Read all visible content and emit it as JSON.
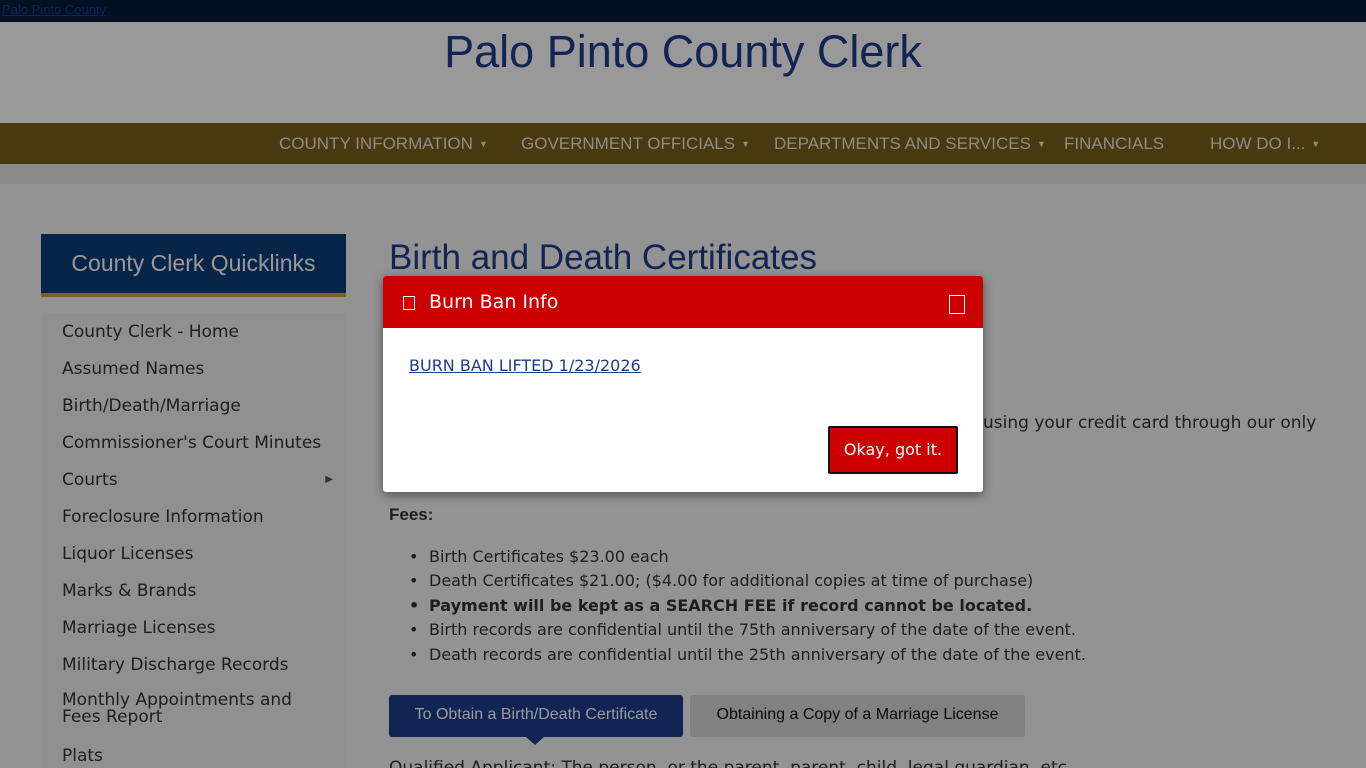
{
  "topbar": {
    "logo_alt": "Palo Pinto County"
  },
  "header": {
    "title": "Palo Pinto County Clerk"
  },
  "nav": {
    "items": [
      {
        "label": "COUNTY INFORMATION",
        "has_dropdown": true
      },
      {
        "label": "GOVERNMENT OFFICIALS",
        "has_dropdown": true
      },
      {
        "label": "DEPARTMENTS AND SERVICES",
        "has_dropdown": true
      },
      {
        "label": "FINANCIALS",
        "has_dropdown": false
      },
      {
        "label": "HOW DO I...",
        "has_dropdown": true
      }
    ],
    "caret_icon": "caret-down-icon",
    "color": "#7a5f18"
  },
  "sidebar": {
    "title": "County Clerk Quicklinks",
    "items": [
      {
        "label": "County Clerk - Home"
      },
      {
        "label": "Assumed Names"
      },
      {
        "label": "Birth/Death/Marriage"
      },
      {
        "label": "Commissioner's Court Minutes"
      },
      {
        "label": "Courts",
        "has_submenu": true
      },
      {
        "label": "Foreclosure Information"
      },
      {
        "label": "Liquor Licenses"
      },
      {
        "label": "Marks & Brands"
      },
      {
        "label": "Marriage Licenses"
      },
      {
        "label": "Military Discharge Records"
      },
      {
        "label": "Monthly Appointments and Fees Report"
      },
      {
        "label": "Plats"
      }
    ]
  },
  "main": {
    "heading": "Birth and Death Certificates",
    "intro_fragment": "using your credit card through our only",
    "fees_label": "Fees:",
    "fees": [
      {
        "text": "Birth Certificates   $23.00 each",
        "bold": false
      },
      {
        "text": "Death Certificates $21.00; ($4.00 for additional copies at time of purchase)",
        "bold": false
      },
      {
        "text": "Payment will be kept as a SEARCH FEE if record cannot be located.",
        "bold": true
      },
      {
        "text": "Birth records are confidential until the 75th anniversary of the date of the event.",
        "bold": false
      },
      {
        "text": "Death records are confidential until the 25th anniversary of the date of the event.",
        "bold": false
      }
    ],
    "tabs": [
      {
        "label": "To Obtain a Birth/Death Certificate",
        "active": true
      },
      {
        "label": "Obtaining a Copy of a Marriage License",
        "active": false
      }
    ],
    "cut_text": "Qualified Applicant: The person, or the parent, parent, child, legal guardian, etc."
  },
  "modal": {
    "title": "Burn Ban Info",
    "title_icon": "alert-icon",
    "close_icon": "close-icon",
    "link": " BURN BAN LIFTED 1/23/2026",
    "button": "Okay, got it.",
    "accent": "#cc0000"
  }
}
